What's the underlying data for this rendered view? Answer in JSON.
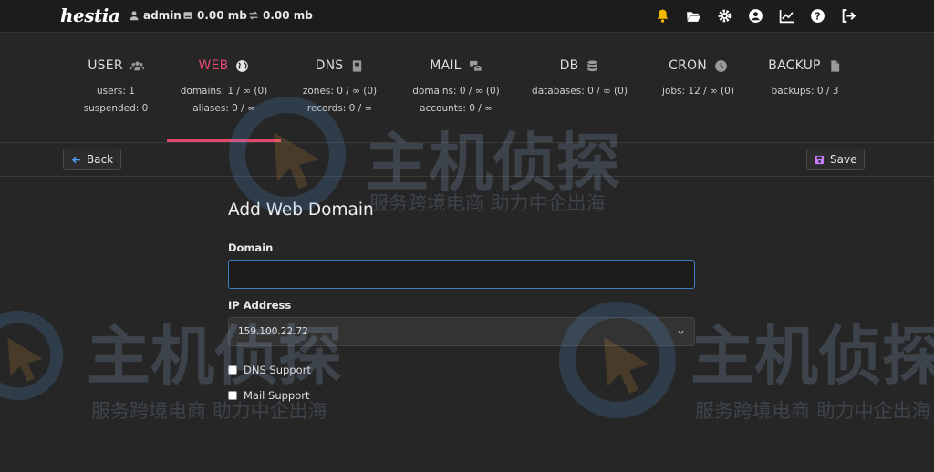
{
  "header": {
    "logo": "hestia",
    "user": "admin",
    "disk": "0.00 mb",
    "bandwidth": "0.00 mb",
    "icons": [
      "bell-icon",
      "folder-open-icon",
      "gear-icon",
      "user-circle-icon",
      "chart-line-icon",
      "question-icon",
      "logout-icon"
    ]
  },
  "tabs": [
    {
      "label": "USER",
      "icon": "users-icon",
      "stats": [
        "users: 1",
        "suspended: 0"
      ]
    },
    {
      "label": "WEB",
      "icon": "globe-icon",
      "stats": [
        "domains: 1 / ∞ (0)",
        "aliases: 0 / ∞"
      ],
      "active": true
    },
    {
      "label": "DNS",
      "icon": "book-icon",
      "stats": [
        "zones: 0 / ∞ (0)",
        "records: 0 / ∞"
      ]
    },
    {
      "label": "MAIL",
      "icon": "mail-bulk-icon",
      "stats": [
        "domains: 0 / ∞ (0)",
        "accounts: 0 / ∞"
      ]
    },
    {
      "label": "DB",
      "icon": "database-icon",
      "stats": [
        "databases: 0 / ∞ (0)"
      ]
    },
    {
      "label": "CRON",
      "icon": "clock-icon",
      "stats": [
        "jobs: 12 / ∞ (0)"
      ]
    },
    {
      "label": "BACKUP",
      "icon": "file-icon",
      "stats": [
        "backups: 0 / 3"
      ]
    }
  ],
  "toolbar": {
    "back_label": "Back",
    "save_label": "Save"
  },
  "form": {
    "title": "Add Web Domain",
    "domain_label": "Domain",
    "domain_value": "",
    "ip_label": "IP Address",
    "ip_value": "159.100.22.72",
    "dns_support_label": "DNS Support",
    "mail_support_label": "Mail Support"
  },
  "watermark": {
    "brand": "主机侦探",
    "slogan": "服务跨境电商 助力中企出海"
  },
  "colors": {
    "accent": "#e0486e",
    "topbar": "#1c1c1c",
    "background": "#262626",
    "focus": "#3f7cc4",
    "bell": "#f5b800",
    "save_icon": "#c77dff"
  }
}
